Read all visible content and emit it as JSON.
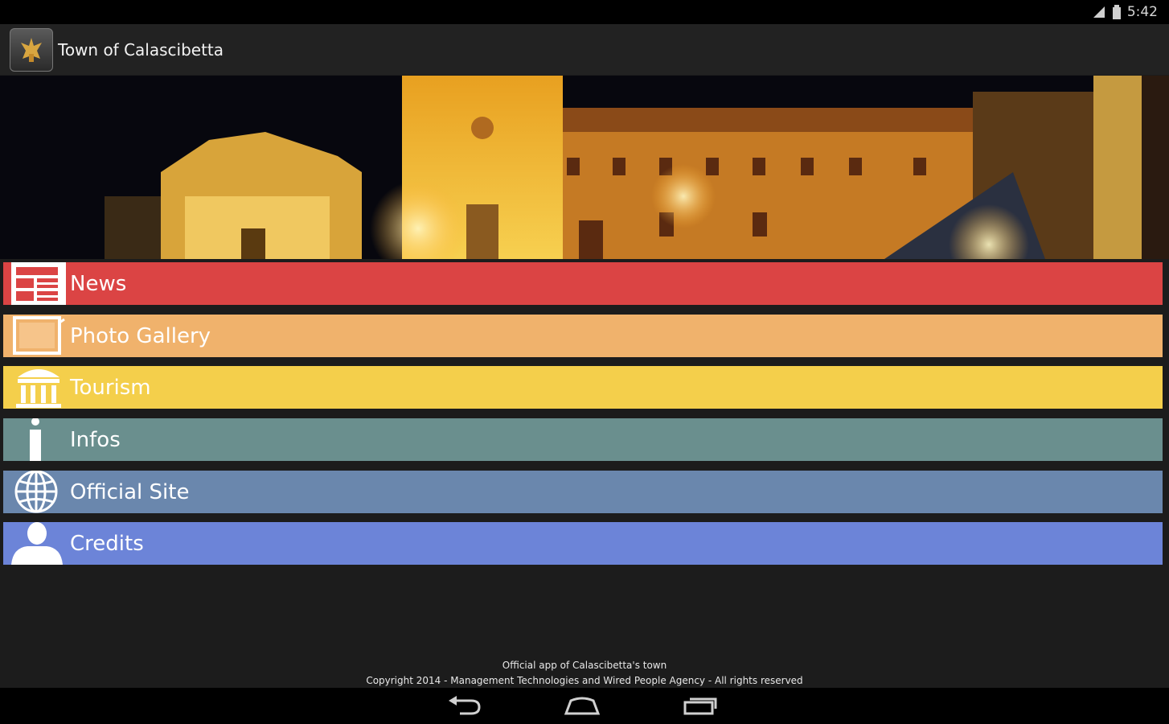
{
  "status_bar": {
    "time": "5:42",
    "icons": [
      "signal-icon",
      "battery-icon"
    ]
  },
  "action_bar": {
    "title": "Town of Calascibetta",
    "logo_icon": "town-crest-icon"
  },
  "banner": {
    "description_icon": "town-night-photo"
  },
  "menu": {
    "items": [
      {
        "label": "News",
        "icon": "newspaper-icon",
        "color": "#db4444"
      },
      {
        "label": "Photo Gallery",
        "icon": "photo-frame-icon",
        "color": "#f0b26c"
      },
      {
        "label": "Tourism",
        "icon": "museum-icon",
        "color": "#f4cf4b"
      },
      {
        "label": "Infos",
        "icon": "info-icon",
        "color": "#6a8f8e"
      },
      {
        "label": "Official Site",
        "icon": "globe-icon",
        "color": "#6a87ad"
      },
      {
        "label": "Credits",
        "icon": "person-icon",
        "color": "#6c84d8"
      }
    ]
  },
  "footer": {
    "line1": "Official app of Calascibetta's town",
    "line2": "Copyright 2014 - Management Technologies and Wired People Agency - All rights reserved"
  },
  "nav_bar": {
    "buttons": [
      "back-icon",
      "home-icon",
      "recent-apps-icon"
    ]
  }
}
